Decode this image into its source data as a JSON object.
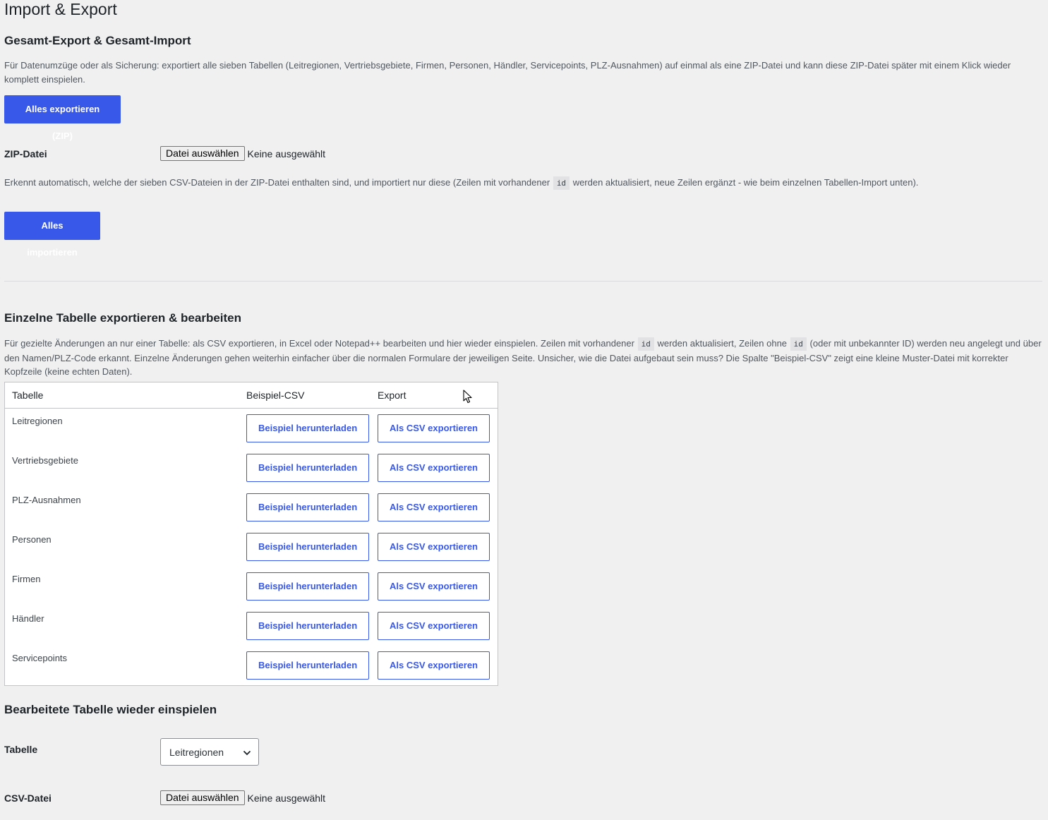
{
  "page": {
    "title": "Import & Export"
  },
  "full": {
    "heading": "Gesamt-Export & Gesamt-Import",
    "description": "Für Datenumzüge oder als Sicherung: exportiert alle sieben Tabellen (Leitregionen, Vertriebsgebiete, Firmen, Personen, Händler, Servicepoints, PLZ-Ausnahmen) auf einmal als eine ZIP-Datei und kann diese ZIP-Datei später mit einem Klick wieder komplett einspielen.",
    "export_button": "Alles exportieren (ZIP)",
    "zip_label": "ZIP-Datei",
    "file_button": "Datei auswählen",
    "file_status": "Keine ausgewählt",
    "import_note_1": "Erkennt automatisch, welche der sieben CSV-Dateien in der ZIP-Datei enthalten sind, und importiert nur diese (Zeilen mit vorhandener",
    "import_note_code": "id",
    "import_note_2": "werden aktualisiert, neue Zeilen ergänzt - wie beim einzelnen Tabellen-Import unten).",
    "import_button": "Alles importieren"
  },
  "single": {
    "heading": "Einzelne Tabelle exportieren & bearbeiten",
    "desc_1": "Für gezielte Änderungen an nur einer Tabelle: als CSV exportieren, in Excel oder Notepad++ bearbeiten und hier wieder einspielen. Zeilen mit vorhandener",
    "desc_code_1": "id",
    "desc_2": "werden aktualisiert, Zeilen ohne",
    "desc_code_2": "id",
    "desc_3": "(oder mit unbekannter ID) werden neu angelegt und über den Namen/PLZ-Code erkannt. Einzelne Änderungen gehen weiterhin einfacher über die normalen Formulare der jeweiligen Seite. Unsicher, wie die Datei aufgebaut sein muss? Die Spalte \"Beispiel-CSV\" zeigt eine kleine Muster-Datei mit korrekter Kopfzeile (keine echten Daten).",
    "columns": [
      "Tabelle",
      "Beispiel-CSV",
      "Export"
    ],
    "rows": [
      {
        "name": "Leitregionen",
        "example": "Beispiel herunterladen",
        "export": "Als CSV exportieren"
      },
      {
        "name": "Vertriebsgebiete",
        "example": "Beispiel herunterladen",
        "export": "Als CSV exportieren"
      },
      {
        "name": "PLZ-Ausnahmen",
        "example": "Beispiel herunterladen",
        "export": "Als CSV exportieren"
      },
      {
        "name": "Personen",
        "example": "Beispiel herunterladen",
        "export": "Als CSV exportieren"
      },
      {
        "name": "Firmen",
        "example": "Beispiel herunterladen",
        "export": "Als CSV exportieren"
      },
      {
        "name": "Händler",
        "example": "Beispiel herunterladen",
        "export": "Als CSV exportieren"
      },
      {
        "name": "Servicepoints",
        "example": "Beispiel herunterladen",
        "export": "Als CSV exportieren"
      }
    ]
  },
  "reimport": {
    "heading": "Bearbeitete Tabelle wieder einspielen",
    "table_label": "Tabelle",
    "table_selected": "Leitregionen",
    "csv_label": "CSV-Datei",
    "file_button": "Datei auswählen",
    "file_status": "Keine ausgewählt"
  },
  "colors": {
    "accent": "#3858e9",
    "background": "#f0f0f1",
    "text": "#1d2327",
    "muted_text": "#50575e"
  },
  "icons": {
    "select": "chevron-down-icon",
    "cursor": "mouse-pointer-icon"
  }
}
